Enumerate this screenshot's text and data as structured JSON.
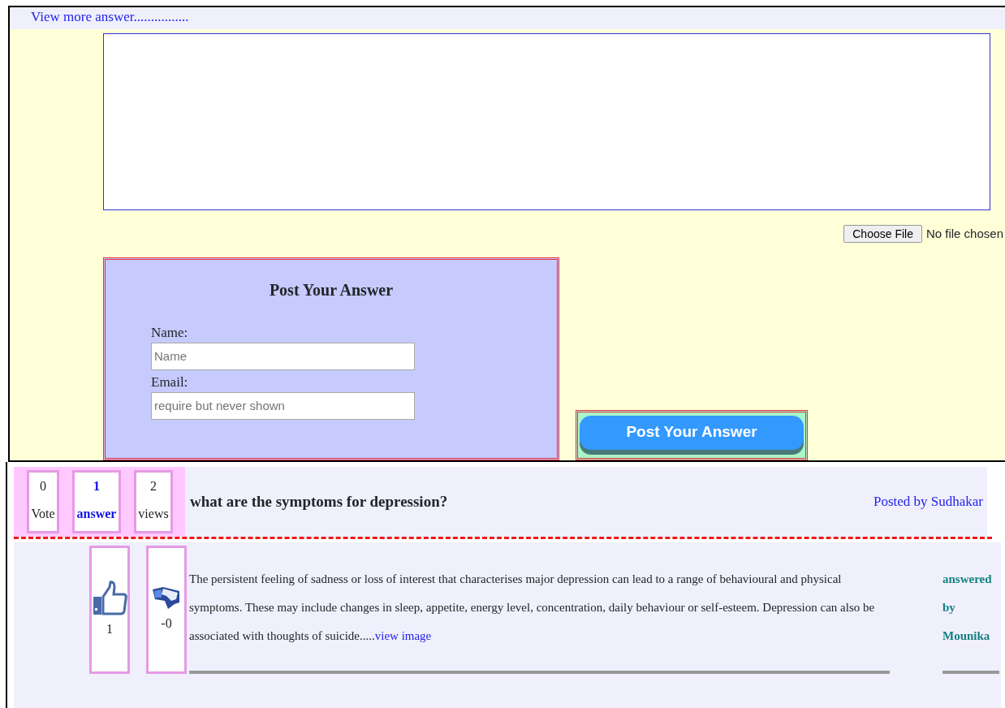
{
  "header_link": "View more answer................",
  "file_input": {
    "button": "Choose File",
    "status": "No file chosen"
  },
  "post_form": {
    "title": "Post Your Answer",
    "fields": [
      {
        "label": "Name:",
        "placeholder": "Name"
      },
      {
        "label": "Email:",
        "placeholder": "require but never shown"
      }
    ]
  },
  "submit_button": "Post Your Answer",
  "question": {
    "stats": [
      {
        "value": "0",
        "label": "Vote",
        "highlighted": false
      },
      {
        "value": "1",
        "label": "answer",
        "highlighted": true
      },
      {
        "value": "2",
        "label": "views",
        "highlighted": false
      }
    ],
    "title": "what are the symptoms for depression?",
    "posted_by": "Posted by Sudhakar"
  },
  "answer": {
    "likes": "1",
    "dislikes": "-0",
    "text": "The persistent feeling of sadness or loss of interest that characterises major depression can lead to a range of behavioural and physical symptoms. These may include changes in sleep, appetite, energy level, concentration, daily behaviour or self-esteem. Depression can also be associated with thoughts of suicide.....",
    "link": "view image",
    "answered_by": "answered by Mounika"
  }
}
